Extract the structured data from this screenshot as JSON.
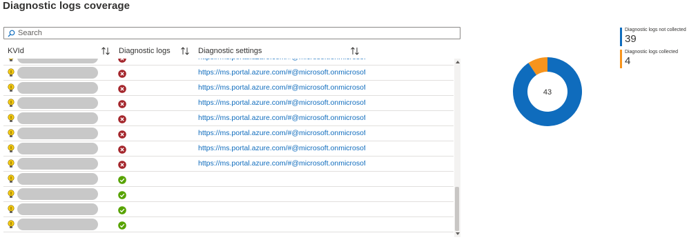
{
  "page": {
    "title": "Diagnostic logs coverage"
  },
  "search": {
    "placeholder": "Search",
    "value": ""
  },
  "table": {
    "columns": [
      {
        "label": "KVId"
      },
      {
        "label": "Diagnostic logs"
      },
      {
        "label": "Diagnostic settings"
      }
    ],
    "rows": [
      {
        "status": "not-collected",
        "link": "https://ms.portal.azure.com/#@microsoft.onmicrosoft.com/"
      },
      {
        "status": "not-collected",
        "link": "https://ms.portal.azure.com/#@microsoft.onmicrosoft.com/"
      },
      {
        "status": "not-collected",
        "link": "https://ms.portal.azure.com/#@microsoft.onmicrosoft.com/"
      },
      {
        "status": "not-collected",
        "link": "https://ms.portal.azure.com/#@microsoft.onmicrosoft.com/"
      },
      {
        "status": "not-collected",
        "link": "https://ms.portal.azure.com/#@microsoft.onmicrosoft.com/"
      },
      {
        "status": "not-collected",
        "link": "https://ms.portal.azure.com/#@microsoft.onmicrosoft.com/"
      },
      {
        "status": "not-collected",
        "link": "https://ms.portal.azure.com/#@microsoft.onmicrosoft.com/"
      },
      {
        "status": "not-collected",
        "link": "https://ms.portal.azure.com/#@microsoft.onmicrosoft.com/"
      },
      {
        "status": "collected",
        "link": ""
      },
      {
        "status": "collected",
        "link": ""
      },
      {
        "status": "collected",
        "link": ""
      },
      {
        "status": "collected",
        "link": ""
      }
    ]
  },
  "donut": {
    "total": "43",
    "segments": [
      {
        "label": "Diagnostic logs not collected",
        "value": 39,
        "color": "#0f6cbd"
      },
      {
        "label": "Diagnostic logs collected",
        "value": 4,
        "color": "#f7941d"
      }
    ]
  },
  "colors": {
    "error": "#a4262c",
    "success": "#57a300",
    "bulb": "#f2c811"
  }
}
